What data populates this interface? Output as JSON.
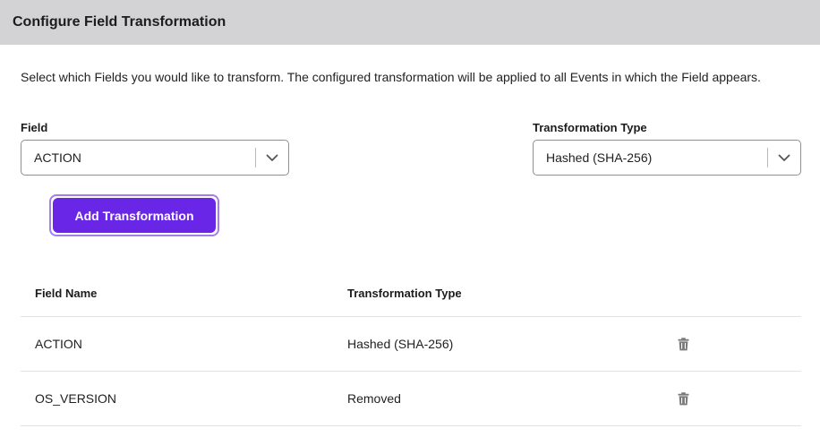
{
  "header": {
    "title": "Configure Field Transformation"
  },
  "description": "Select which Fields you would like to transform. The configured transformation will be applied to all Events in which the Field appears.",
  "form": {
    "field_label": "Field",
    "field_value": "ACTION",
    "type_label": "Transformation Type",
    "type_value": "Hashed (SHA-256)",
    "add_button": "Add Transformation"
  },
  "table": {
    "headers": [
      "Field Name",
      "Transformation Type"
    ],
    "rows": [
      {
        "field": "ACTION",
        "type": "Hashed (SHA-256)",
        "action_icon": "trash-icon"
      },
      {
        "field": "OS_VERSION",
        "type": "Removed",
        "action_icon": "trash-icon"
      }
    ]
  },
  "colors": {
    "primary": "#6a26e6",
    "header_bg": "#d3d3d5",
    "icon": "#7a7a7a"
  }
}
